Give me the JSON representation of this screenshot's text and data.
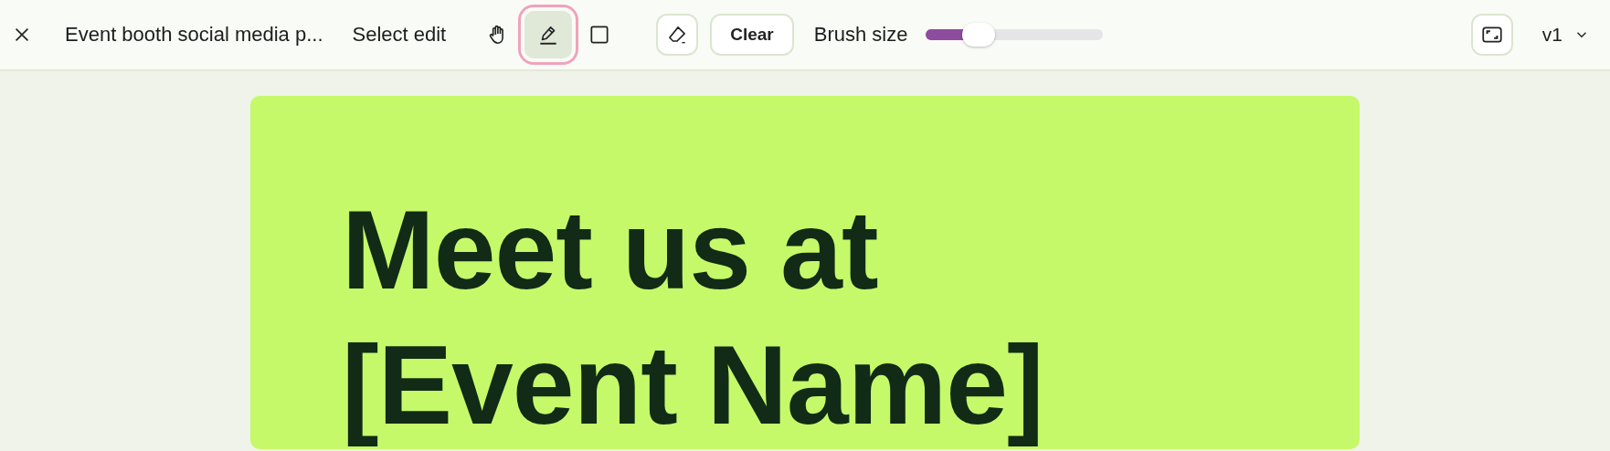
{
  "toolbar": {
    "title": "Event booth social media p...",
    "mode": "Select edit",
    "tools": [
      {
        "kind": "hand",
        "selected": false
      },
      {
        "kind": "brush",
        "selected": true
      },
      {
        "kind": "rect",
        "selected": false
      }
    ],
    "clear": "Clear",
    "brush_size": {
      "label": "Brush size",
      "level": 0.25
    },
    "version": "v1"
  },
  "canvas": {
    "headline": [
      "Meet us at",
      "[Event Name]"
    ]
  }
}
